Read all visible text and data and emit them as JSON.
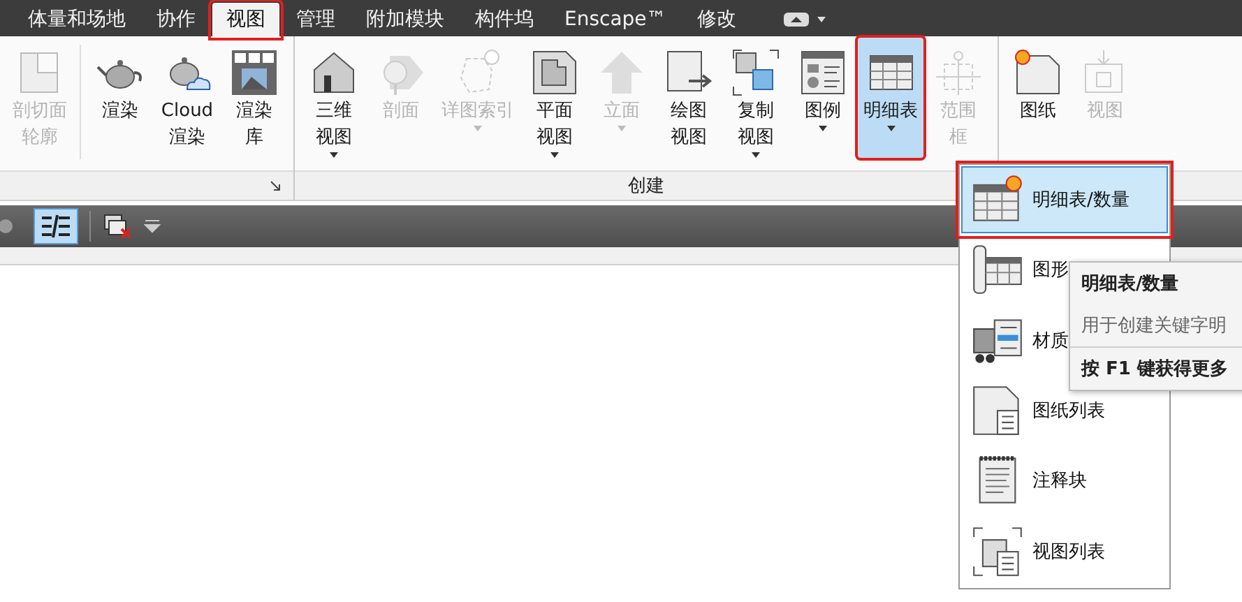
{
  "menu_tabs": [
    {
      "label": "体量和场地",
      "selected": false
    },
    {
      "label": "协作",
      "selected": false
    },
    {
      "label": "视图",
      "selected": true
    },
    {
      "label": "管理",
      "selected": false
    },
    {
      "label": "附加模块",
      "selected": false
    },
    {
      "label": "构件坞",
      "selected": false
    },
    {
      "label": "Enscape™",
      "selected": false
    },
    {
      "label": "修改",
      "selected": false
    }
  ],
  "ribbon": {
    "panels": [
      {
        "launcher": true,
        "groups": [
          [
            {
              "kind": "section-box",
              "lines": [
                "剖切面",
                "轮廓"
              ],
              "disabled": true,
              "dropdown": false,
              "selected": false
            }
          ],
          [
            {
              "kind": "teapot",
              "lines": [
                "渲染"
              ],
              "disabled": false,
              "dropdown": false,
              "selected": false
            },
            {
              "kind": "cloud-teapot",
              "lines": [
                "Cloud",
                "渲染"
              ],
              "disabled": false,
              "dropdown": false,
              "selected": false
            },
            {
              "kind": "gallery",
              "lines": [
                "渲染",
                "库"
              ],
              "disabled": false,
              "dropdown": false,
              "selected": false
            }
          ]
        ]
      },
      {
        "title": "创建",
        "launcher": false,
        "groups": [
          [
            {
              "kind": "house",
              "lines": [
                "三维",
                "视图"
              ],
              "disabled": false,
              "dropdown": true,
              "selected": false
            },
            {
              "kind": "section",
              "lines": [
                "剖面"
              ],
              "disabled": true,
              "dropdown": false,
              "selected": false
            },
            {
              "kind": "callout",
              "lines": [
                "详图索引"
              ],
              "disabled": true,
              "dropdown": true,
              "selected": false
            },
            {
              "kind": "plan",
              "lines": [
                "平面",
                "视图"
              ],
              "disabled": false,
              "dropdown": true,
              "selected": false
            },
            {
              "kind": "elevation",
              "lines": [
                "立面"
              ],
              "disabled": true,
              "dropdown": true,
              "selected": false
            },
            {
              "kind": "drafting",
              "lines": [
                "绘图",
                "视图"
              ],
              "disabled": false,
              "dropdown": false,
              "selected": false
            },
            {
              "kind": "duplicate",
              "lines": [
                "复制",
                "视图"
              ],
              "disabled": false,
              "dropdown": true,
              "selected": false
            },
            {
              "kind": "legend",
              "lines": [
                "图例"
              ],
              "disabled": false,
              "dropdown": true,
              "selected": false
            },
            {
              "kind": "schedule",
              "lines": [
                "明细表"
              ],
              "disabled": false,
              "dropdown": true,
              "selected": true
            },
            {
              "kind": "scope-box",
              "lines": [
                "范围",
                "框"
              ],
              "disabled": true,
              "dropdown": false,
              "selected": false
            }
          ]
        ]
      },
      {
        "launcher": false,
        "groups": [
          [
            {
              "kind": "sheet",
              "lines": [
                "图纸"
              ],
              "disabled": false,
              "dropdown": false,
              "selected": false
            },
            {
              "kind": "view-place",
              "lines": [
                "视图"
              ],
              "disabled": true,
              "dropdown": false,
              "selected": false
            }
          ]
        ]
      }
    ]
  },
  "schedule_menu": {
    "items": [
      {
        "kind": "schedule",
        "label": "明细表/数量",
        "selected": true
      },
      {
        "kind": "column",
        "label": "图形",
        "selected": false
      },
      {
        "kind": "material",
        "label": "材质",
        "selected": false
      },
      {
        "kind": "sheet-list",
        "label": "图纸列表",
        "selected": false
      },
      {
        "kind": "note",
        "label": "注释块",
        "selected": false
      },
      {
        "kind": "view-list",
        "label": "视图列表",
        "selected": false
      }
    ]
  },
  "tooltip": {
    "title": "明细表/数量",
    "description": "用于创建关键字明",
    "help": "按 F1 键获得更多"
  }
}
